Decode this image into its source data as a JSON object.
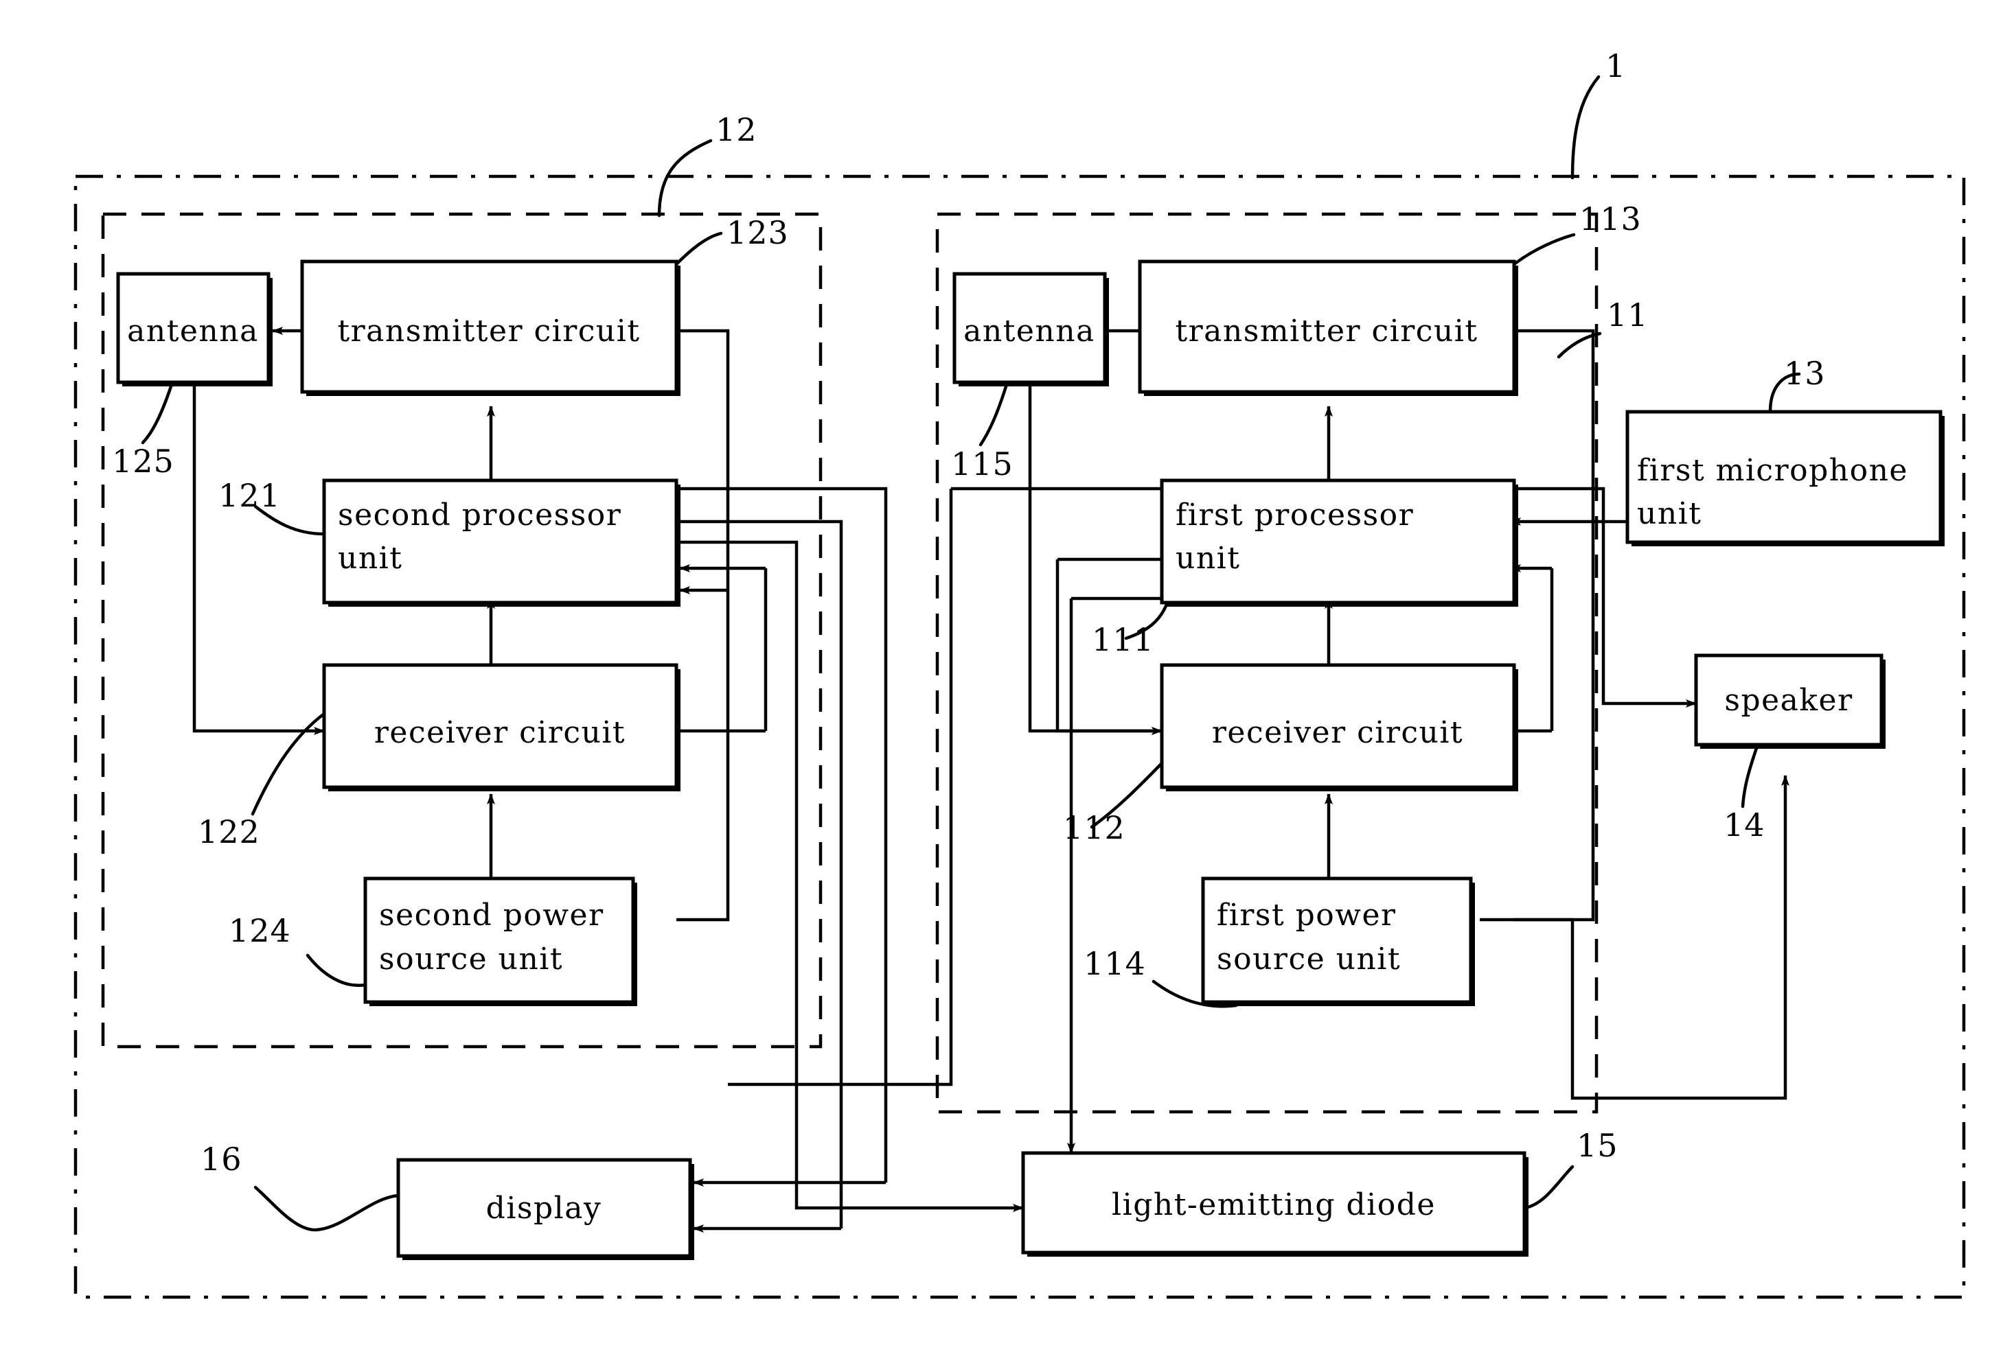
{
  "figure": {
    "type": "patent-block-diagram",
    "title": "",
    "background_color": "#ffffff",
    "line_color": "#000000"
  },
  "boundaries": [
    {
      "id": "outer",
      "ref": "1",
      "name": "system-boundary",
      "style": "dash-dot"
    },
    {
      "id": "second-module",
      "ref": "12",
      "name": "second-module-boundary",
      "style": "dashed"
    },
    {
      "id": "first-module",
      "ref": "11",
      "name": "first-module-boundary",
      "style": "dashed"
    }
  ],
  "blocks": [
    {
      "id": "antenna2",
      "label": "antenna",
      "ref": "125"
    },
    {
      "id": "tx2",
      "label": "transmitter circuit",
      "ref": "123"
    },
    {
      "id": "proc2",
      "label": "second processor\nunit",
      "ref": "121",
      "line1": "second processor",
      "line2": "unit"
    },
    {
      "id": "rx2",
      "label": "receiver circuit",
      "ref": "122"
    },
    {
      "id": "pwr2",
      "label": "second power\nsource unit",
      "ref": "124",
      "line1": "second power",
      "line2": "source unit"
    },
    {
      "id": "antenna1",
      "label": "antenna",
      "ref": "115"
    },
    {
      "id": "tx1",
      "label": "transmitter circuit",
      "ref": "113"
    },
    {
      "id": "proc1",
      "label": "first processor\nunit",
      "ref": "111",
      "line1": "first processor",
      "line2": "unit"
    },
    {
      "id": "rx1",
      "label": "receiver circuit",
      "ref": "112"
    },
    {
      "id": "pwr1",
      "label": "first power\nsource unit",
      "ref": "114",
      "line1": "first power",
      "line2": "source unit"
    },
    {
      "id": "mic1",
      "label": "first microphone\nunit",
      "ref": "13",
      "line1": "first microphone",
      "line2": "unit"
    },
    {
      "id": "speaker",
      "label": "speaker",
      "ref": "14"
    },
    {
      "id": "display",
      "label": "display",
      "ref": "16"
    },
    {
      "id": "led",
      "label": "light-emitting diode",
      "ref": "15"
    }
  ],
  "labels": {
    "antenna_2": "antenna",
    "transmitter_circuit_2": "transmitter circuit",
    "second_processor_l1": "second processor",
    "second_processor_l2": "unit",
    "receiver_circuit_2": "receiver circuit",
    "second_power_l1": "second power",
    "second_power_l2": "source unit",
    "antenna_1": "antenna",
    "transmitter_circuit_1": "transmitter circuit",
    "first_processor_l1": "first processor",
    "first_processor_l2": "unit",
    "receiver_circuit_1": "receiver circuit",
    "first_power_l1": "first power",
    "first_power_l2": "source unit",
    "first_microphone_l1": "first microphone",
    "first_microphone_l2": "unit",
    "speaker": "speaker",
    "display": "display",
    "led": "light-emitting diode"
  },
  "refs": {
    "system": "1",
    "first_module": "11",
    "first_processor": "111",
    "first_receiver": "112",
    "first_transmitter": "113",
    "first_power": "114",
    "first_antenna": "115",
    "second_module": "12",
    "second_processor": "121",
    "second_receiver": "122",
    "second_transmitter": "123",
    "second_power": "124",
    "second_antenna": "125",
    "microphone": "13",
    "speaker": "14",
    "led": "15",
    "display": "16"
  }
}
